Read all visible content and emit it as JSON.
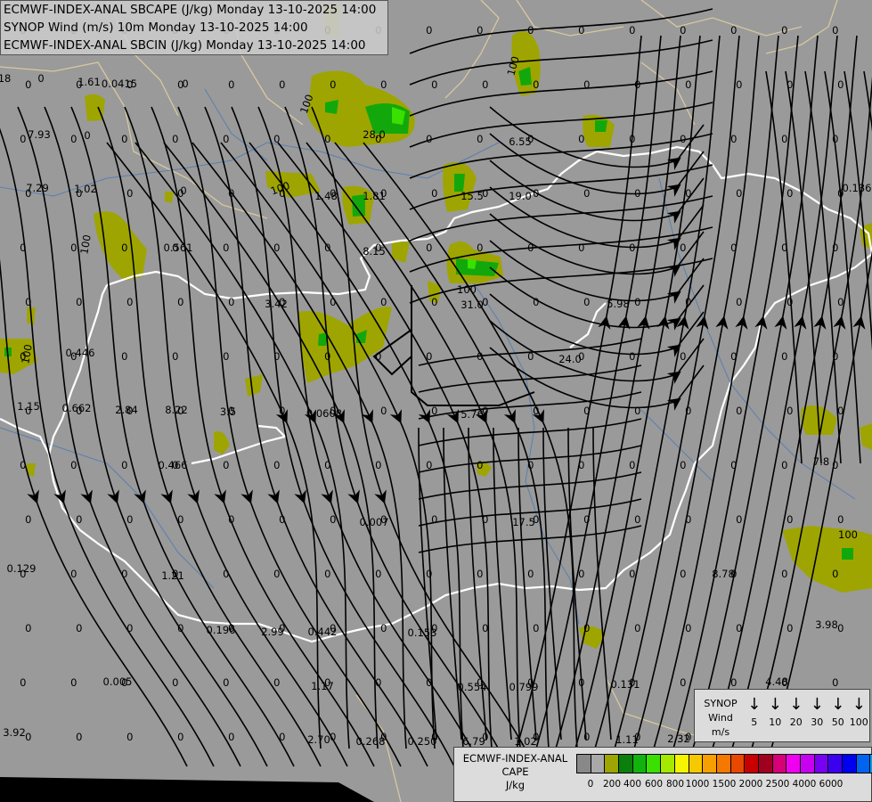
{
  "titles": {
    "line1": "ECMWF-INDEX-ANAL SBCAPE (J/kg) Monday 13-10-2025 14:00",
    "line2": "SYNOP Wind (m/s) 10m Monday 13-10-2025 14:00",
    "line3": "ECMWF-INDEX-ANAL SBCIN (J/kg) Monday 13-10-2025 14:00"
  },
  "colors": {
    "background": "#9a9a9a",
    "cape_low": "#9ea500",
    "cape_mid": "#12a80c",
    "cape_high": "#39e000",
    "borders": "#ffffff",
    "rivers": "#5a7fb0",
    "regions": "#d8c8a0",
    "streamlines": "#000000"
  },
  "map_values": [
    {
      "text": "18"
    },
    {
      "text": "0"
    },
    {
      "text": "1.61"
    },
    {
      "text": "0.0415"
    },
    {
      "text": "0"
    },
    {
      "text": "7.93"
    },
    {
      "text": "0"
    },
    {
      "text": "7.29"
    },
    {
      "text": "1.02"
    },
    {
      "text": "0"
    },
    {
      "text": "0.561"
    },
    {
      "text": "0.446"
    },
    {
      "text": "1.15"
    },
    {
      "text": "0.662"
    },
    {
      "text": "2.84"
    },
    {
      "text": "8.22"
    },
    {
      "text": "3.5"
    },
    {
      "text": "0.0608"
    },
    {
      "text": "0.466"
    },
    {
      "text": "0.007"
    },
    {
      "text": "0.129"
    },
    {
      "text": "1.21"
    },
    {
      "text": "0.196"
    },
    {
      "text": "2.99"
    },
    {
      "text": "0.442"
    },
    {
      "text": "0.153"
    },
    {
      "text": "0.005"
    },
    {
      "text": "1.17"
    },
    {
      "text": "0.554"
    },
    {
      "text": "0.799"
    },
    {
      "text": "0.131"
    },
    {
      "text": "3.92"
    },
    {
      "text": "2.70"
    },
    {
      "text": "0.268"
    },
    {
      "text": "0.250"
    },
    {
      "text": "6.79"
    },
    {
      "text": "1.02"
    },
    {
      "text": "1.11"
    },
    {
      "text": "2.32"
    },
    {
      "text": "7.35"
    },
    {
      "text": "4.48"
    },
    {
      "text": "3.98"
    },
    {
      "text": "8.78"
    },
    {
      "text": "17.5"
    },
    {
      "text": "5.76"
    },
    {
      "text": "24.0"
    },
    {
      "text": "5.98"
    },
    {
      "text": "31.0"
    },
    {
      "text": "15.5"
    },
    {
      "text": "19.0"
    },
    {
      "text": "6.55"
    },
    {
      "text": "8.15"
    },
    {
      "text": "1.48"
    },
    {
      "text": "1.81"
    },
    {
      "text": "3.42"
    },
    {
      "text": "28.0"
    },
    {
      "text": "0.136"
    },
    {
      "text": "7.8"
    },
    {
      "text": "100"
    },
    {
      "text": "100"
    },
    {
      "text": "100"
    },
    {
      "text": "100"
    },
    {
      "text": "100"
    },
    {
      "text": "100"
    },
    {
      "text": "100"
    }
  ],
  "synop_legend": {
    "label_line1": "SYNOP",
    "label_line2": "Wind",
    "label_line3": "m/s",
    "items": [
      {
        "arrow": "↓",
        "value": "5"
      },
      {
        "arrow": "↓",
        "value": "10"
      },
      {
        "arrow": "↓",
        "value": "20"
      },
      {
        "arrow": "↓",
        "value": "30"
      },
      {
        "arrow": "↓",
        "value": "50"
      },
      {
        "arrow": "↓",
        "value": "100"
      }
    ]
  },
  "cape_legend": {
    "title_line1": "ECMWF-INDEX-ANAL",
    "title_line2": "CAPE",
    "title_line3": "J/kg",
    "swatches": [
      "#888888",
      "#a9a9a9",
      "#9ea500",
      "#0b7f0b",
      "#12b30c",
      "#3ae000",
      "#a5e800",
      "#f5f500",
      "#f5c800",
      "#f5a000",
      "#f57800",
      "#e84800",
      "#c80000",
      "#a00020",
      "#d80078",
      "#f000f0",
      "#c800f0",
      "#7800f0",
      "#3c00f0",
      "#0000f0",
      "#0064f0",
      "#00a0f0",
      "#00e6f0",
      "#f0f0f0"
    ],
    "ticks": [
      "0",
      "200",
      "400",
      "600",
      "800",
      "1000",
      "1500",
      "2000",
      "2500",
      "4000",
      "6000"
    ]
  }
}
